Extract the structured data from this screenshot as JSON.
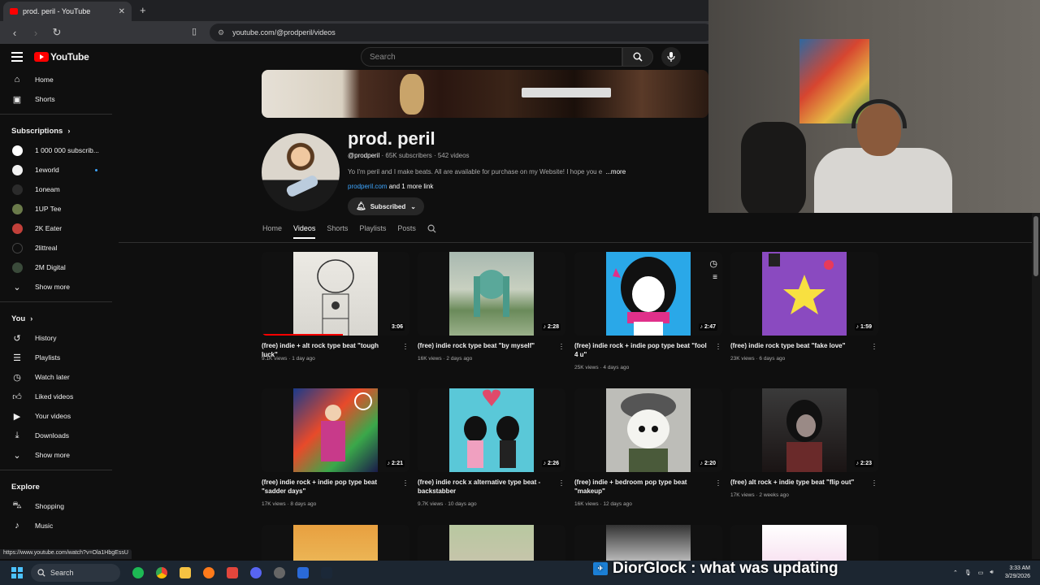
{
  "browser": {
    "tab_title": "prod. peril - YouTube",
    "tab_close": "✕",
    "new_tab": "+",
    "url": "youtube.com/@prodperil/videos",
    "status_url": "https://www.youtube.com/watch?v=Ola1HbgEssU"
  },
  "yt": {
    "logo_text": "YouTube",
    "search_placeholder": "Search"
  },
  "sidebar": {
    "main": [
      {
        "label": "Home",
        "icon": "home-icon"
      },
      {
        "label": "Shorts",
        "icon": "shorts-icon"
      }
    ],
    "subscriptions_header": "Subscriptions",
    "subscriptions": [
      {
        "label": "1 000 000 subscrib...",
        "color": "#ffffff"
      },
      {
        "label": "1eworld",
        "color": "#f2f2f2"
      },
      {
        "label": "1oneam",
        "color": "#2b2b2b"
      },
      {
        "label": "1UP Tee",
        "color": "#6a7a4a"
      },
      {
        "label": "2K Eater",
        "color": "#c2403a"
      },
      {
        "label": "2littreal",
        "color": "#0f0f0f"
      },
      {
        "label": "2M Digital",
        "color": "#3a4a3a"
      }
    ],
    "show_more": "Show more",
    "you_header": "You",
    "you": [
      {
        "label": "History",
        "icon": "history-icon"
      },
      {
        "label": "Playlists",
        "icon": "playlists-icon"
      },
      {
        "label": "Watch later",
        "icon": "watch-later-icon"
      },
      {
        "label": "Liked videos",
        "icon": "thumbs-up-icon"
      },
      {
        "label": "Your videos",
        "icon": "your-videos-icon"
      },
      {
        "label": "Downloads",
        "icon": "download-icon"
      }
    ],
    "show_more_2": "Show more",
    "explore_header": "Explore",
    "explore": [
      {
        "label": "Shopping",
        "icon": "shopping-bag-icon"
      },
      {
        "label": "Music",
        "icon": "music-note-icon"
      }
    ]
  },
  "channel": {
    "name": "prod. peril",
    "handle": "@prodperil",
    "stats": "· 65K subscribers · 542 videos",
    "description": "Yo I'm peril and I make beats. All are available for purchase on my Website! I hope you e",
    "more": "...more",
    "link": "prodperil.com",
    "more_links": "and 1 more link",
    "subscribed": "Subscribed"
  },
  "tabs": [
    "Home",
    "Videos",
    "Shorts",
    "Playlists",
    "Posts"
  ],
  "videos": [
    {
      "title": "(free) indie + alt rock type beat \"tough luck\"",
      "meta": "9.1K views · 1 day ago",
      "duration": "3:06",
      "art": "a1"
    },
    {
      "title": "(free) indie rock type beat \"by myself\"",
      "meta": "16K views · 2 days ago",
      "duration": "♪ 2:28",
      "art": "a2"
    },
    {
      "title": "(free) indie rock + indie pop type beat \"fool 4 u\"",
      "meta": "25K views · 4 days ago",
      "duration": "♪ 2:47",
      "art": "a3"
    },
    {
      "title": "(free) indie rock type beat \"fake love\"",
      "meta": "23K views · 6 days ago",
      "duration": "♪ 1:59",
      "art": "a4"
    },
    {
      "title": "(free) indie rock + indie pop type beat \"sadder days\"",
      "meta": "17K views · 8 days ago",
      "duration": "♪ 2:21",
      "art": "a5"
    },
    {
      "title": "(free) indie rock x alternative type beat - backstabber",
      "meta": "9.7K views · 10 days ago",
      "duration": "♪ 2:26",
      "art": "a6"
    },
    {
      "title": "(free) indie + bedroom pop type beat \"makeup\"",
      "meta": "16K views · 12 days ago",
      "duration": "♪ 2:20",
      "art": "a7"
    },
    {
      "title": "(free) alt rock + indie type beat \"flip out\"",
      "meta": "17K views · 2 weeks ago",
      "duration": "♪ 2:23",
      "art": "a8"
    }
  ],
  "watched_progress_first_video": 0.55,
  "stream_overlay": "DiorGlock : what was updating",
  "taskbar": {
    "search": "Search",
    "time": "3:33 AM",
    "date": "3/29/2026"
  },
  "colors": {
    "accent_red": "#ff0000",
    "link_blue": "#3ea6ff",
    "bg": "#0f0f0f"
  }
}
